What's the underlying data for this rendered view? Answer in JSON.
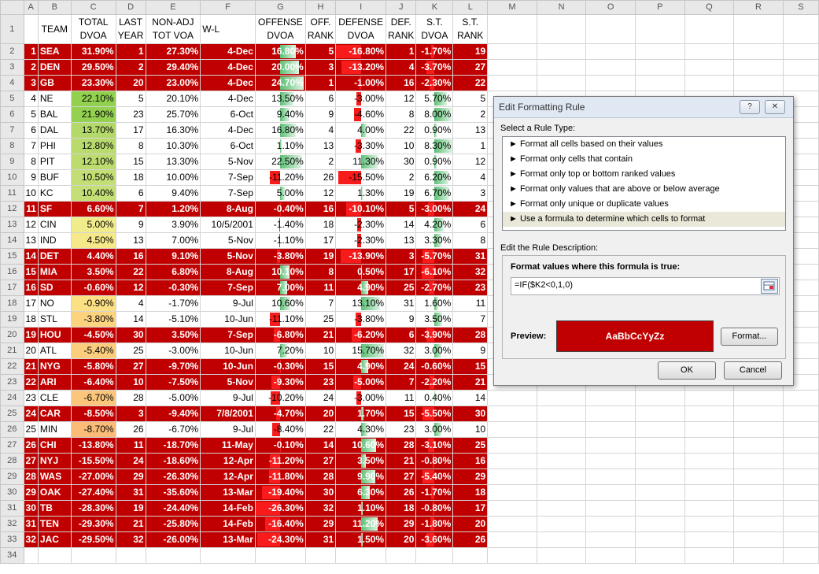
{
  "columns": [
    "A",
    "B",
    "C",
    "D",
    "E",
    "F",
    "G",
    "H",
    "I",
    "J",
    "K",
    "L",
    "M",
    "N",
    "O",
    "P",
    "Q",
    "R",
    "S"
  ],
  "header1": [
    "",
    "",
    "TOTAL",
    "LAST",
    "NON-ADJ",
    "",
    "OFFENSE",
    "OFF.",
    "DEFENSE",
    "DEF.",
    "S.T.",
    "S.T."
  ],
  "header2": [
    "",
    "TEAM",
    "DVOA",
    "YEAR",
    "TOT VOA",
    "W-L",
    "DVOA",
    "RANK",
    "DVOA",
    "RANK",
    "DVOA",
    "RANK"
  ],
  "rows": [
    {
      "rank": "1",
      "team": "SEA",
      "dvoa": "31.90%",
      "last": "1",
      "nonadj": "27.30%",
      "wl": "4-Dec",
      "off": "16.80%",
      "offr": "5",
      "def": "-16.80%",
      "defr": "1",
      "st": "-1.70%",
      "str": "19",
      "neg": true,
      "dvoa_color": "",
      "offv": 16.8,
      "defv": -16.8,
      "stv": -1.7
    },
    {
      "rank": "2",
      "team": "DEN",
      "dvoa": "29.50%",
      "last": "2",
      "nonadj": "29.40%",
      "wl": "4-Dec",
      "off": "20.00%",
      "offr": "3",
      "def": "-13.20%",
      "defr": "4",
      "st": "-3.70%",
      "str": "27",
      "neg": true,
      "dvoa_color": "",
      "offv": 20.0,
      "defv": -13.2,
      "stv": -3.7
    },
    {
      "rank": "3",
      "team": "GB",
      "dvoa": "23.30%",
      "last": "20",
      "nonadj": "23.00%",
      "wl": "4-Dec",
      "off": "24.70%",
      "offr": "1",
      "def": "-1.00%",
      "defr": "16",
      "st": "-2.30%",
      "str": "22",
      "neg": true,
      "dvoa_color": "",
      "offv": 24.7,
      "defv": -1.0,
      "stv": -2.3
    },
    {
      "rank": "4",
      "team": "NE",
      "dvoa": "22.10%",
      "last": "5",
      "nonadj": "20.10%",
      "wl": "4-Dec",
      "off": "13.50%",
      "offr": "6",
      "def": "-3.00%",
      "defr": "12",
      "st": "5.70%",
      "str": "5",
      "neg": false,
      "dvoa_color": "#92d050",
      "offv": 13.5,
      "defv": -3.0,
      "stv": 5.7
    },
    {
      "rank": "5",
      "team": "BAL",
      "dvoa": "21.90%",
      "last": "23",
      "nonadj": "25.70%",
      "wl": "6-Oct",
      "off": "9.40%",
      "offr": "9",
      "def": "-4.60%",
      "defr": "8",
      "st": "8.00%",
      "str": "2",
      "neg": false,
      "dvoa_color": "#95d151",
      "offv": 9.4,
      "defv": -4.6,
      "stv": 8.0
    },
    {
      "rank": "6",
      "team": "DAL",
      "dvoa": "13.70%",
      "last": "17",
      "nonadj": "16.30%",
      "wl": "4-Dec",
      "off": "16.80%",
      "offr": "4",
      "def": "4.00%",
      "defr": "22",
      "st": "0.90%",
      "str": "13",
      "neg": false,
      "dvoa_color": "#b4d96b",
      "offv": 16.8,
      "defv": 4.0,
      "stv": 0.9
    },
    {
      "rank": "7",
      "team": "PHI",
      "dvoa": "12.80%",
      "last": "8",
      "nonadj": "10.30%",
      "wl": "6-Oct",
      "off": "1.10%",
      "offr": "13",
      "def": "-3.30%",
      "defr": "10",
      "st": "8.30%",
      "str": "1",
      "neg": false,
      "dvoa_color": "#b9db6e",
      "offv": 1.1,
      "defv": -3.3,
      "stv": 8.3
    },
    {
      "rank": "8",
      "team": "PIT",
      "dvoa": "12.10%",
      "last": "15",
      "nonadj": "13.30%",
      "wl": "5-Nov",
      "off": "22.50%",
      "offr": "2",
      "def": "11.30%",
      "defr": "30",
      "st": "0.90%",
      "str": "12",
      "neg": false,
      "dvoa_color": "#bcdc70",
      "offv": 22.5,
      "defv": 11.3,
      "stv": 0.9
    },
    {
      "rank": "9",
      "team": "BUF",
      "dvoa": "10.50%",
      "last": "18",
      "nonadj": "10.00%",
      "wl": "7-Sep",
      "off": "-11.20%",
      "offr": "26",
      "def": "-15.50%",
      "defr": "2",
      "st": "6.20%",
      "str": "4",
      "neg": false,
      "dvoa_color": "#c2de74",
      "offv": -11.2,
      "defv": -15.5,
      "stv": 6.2
    },
    {
      "rank": "10",
      "team": "KC",
      "dvoa": "10.40%",
      "last": "6",
      "nonadj": "9.40%",
      "wl": "7-Sep",
      "off": "5.00%",
      "offr": "12",
      "def": "1.30%",
      "defr": "19",
      "st": "6.70%",
      "str": "3",
      "neg": false,
      "dvoa_color": "#c3df75",
      "offv": 5.0,
      "defv": 1.3,
      "stv": 6.7
    },
    {
      "rank": "11",
      "team": "SF",
      "dvoa": "6.60%",
      "last": "7",
      "nonadj": "1.20%",
      "wl": "8-Aug",
      "off": "-0.40%",
      "offr": "16",
      "def": "-10.10%",
      "defr": "5",
      "st": "-3.00%",
      "str": "24",
      "neg": true,
      "dvoa_color": "",
      "offv": -0.4,
      "defv": -10.1,
      "stv": -3.0
    },
    {
      "rank": "12",
      "team": "CIN",
      "dvoa": "5.00%",
      "last": "9",
      "nonadj": "3.90%",
      "wl": "10/5/2001",
      "off": "-1.40%",
      "offr": "18",
      "def": "-2.30%",
      "defr": "14",
      "st": "4.20%",
      "str": "6",
      "neg": false,
      "dvoa_color": "#f0ec8c",
      "offv": -1.4,
      "defv": -2.3,
      "stv": 4.2
    },
    {
      "rank": "13",
      "team": "IND",
      "dvoa": "4.50%",
      "last": "13",
      "nonadj": "7.00%",
      "wl": "5-Nov",
      "off": "-1.10%",
      "offr": "17",
      "def": "-2.30%",
      "defr": "13",
      "st": "3.30%",
      "str": "8",
      "neg": false,
      "dvoa_color": "#f5e98a",
      "offv": -1.1,
      "defv": -2.3,
      "stv": 3.3
    },
    {
      "rank": "14",
      "team": "DET",
      "dvoa": "4.40%",
      "last": "16",
      "nonadj": "9.10%",
      "wl": "5-Nov",
      "off": "-3.80%",
      "offr": "19",
      "def": "-13.90%",
      "defr": "3",
      "st": "-5.70%",
      "str": "31",
      "neg": true,
      "dvoa_color": "",
      "offv": -3.8,
      "defv": -13.9,
      "stv": -5.7
    },
    {
      "rank": "15",
      "team": "MIA",
      "dvoa": "3.50%",
      "last": "22",
      "nonadj": "6.80%",
      "wl": "8-Aug",
      "off": "10.10%",
      "offr": "8",
      "def": "0.50%",
      "defr": "17",
      "st": "-6.10%",
      "str": "32",
      "neg": true,
      "dvoa_color": "",
      "offv": 10.1,
      "defv": 0.5,
      "stv": -6.1
    },
    {
      "rank": "16",
      "team": "SD",
      "dvoa": "-0.60%",
      "last": "12",
      "nonadj": "-0.30%",
      "wl": "7-Sep",
      "off": "7.00%",
      "offr": "11",
      "def": "4.90%",
      "defr": "25",
      "st": "-2.70%",
      "str": "23",
      "neg": true,
      "dvoa_color": "",
      "offv": 7.0,
      "defv": 4.9,
      "stv": -2.7
    },
    {
      "rank": "17",
      "team": "NO",
      "dvoa": "-0.90%",
      "last": "4",
      "nonadj": "-1.70%",
      "wl": "9-Jul",
      "off": "10.60%",
      "offr": "7",
      "def": "13.10%",
      "defr": "31",
      "st": "1.60%",
      "str": "11",
      "neg": false,
      "dvoa_color": "#fce184",
      "offv": 10.6,
      "defv": 13.1,
      "stv": 1.6
    },
    {
      "rank": "18",
      "team": "STL",
      "dvoa": "-3.80%",
      "last": "14",
      "nonadj": "-5.10%",
      "wl": "10-Jun",
      "off": "-11.10%",
      "offr": "25",
      "def": "-3.80%",
      "defr": "9",
      "st": "3.50%",
      "str": "7",
      "neg": false,
      "dvoa_color": "#fcd37f",
      "offv": -11.1,
      "defv": -3.8,
      "stv": 3.5
    },
    {
      "rank": "19",
      "team": "HOU",
      "dvoa": "-4.50%",
      "last": "30",
      "nonadj": "3.50%",
      "wl": "7-Sep",
      "off": "-6.80%",
      "offr": "21",
      "def": "-6.20%",
      "defr": "6",
      "st": "-3.90%",
      "str": "28",
      "neg": true,
      "dvoa_color": "",
      "offv": -6.8,
      "defv": -6.2,
      "stv": -3.9
    },
    {
      "rank": "20",
      "team": "ATL",
      "dvoa": "-5.40%",
      "last": "25",
      "nonadj": "-3.00%",
      "wl": "10-Jun",
      "off": "7.20%",
      "offr": "10",
      "def": "15.70%",
      "defr": "32",
      "st": "3.00%",
      "str": "9",
      "neg": false,
      "dvoa_color": "#fccd7d",
      "offv": 7.2,
      "defv": 15.7,
      "stv": 3.0
    },
    {
      "rank": "21",
      "team": "NYG",
      "dvoa": "-5.80%",
      "last": "27",
      "nonadj": "-9.70%",
      "wl": "10-Jun",
      "off": "-0.30%",
      "offr": "15",
      "def": "4.90%",
      "defr": "24",
      "st": "-0.60%",
      "str": "15",
      "neg": true,
      "dvoa_color": "",
      "offv": -0.3,
      "defv": 4.9,
      "stv": -0.6
    },
    {
      "rank": "22",
      "team": "ARI",
      "dvoa": "-6.40%",
      "last": "10",
      "nonadj": "-7.50%",
      "wl": "5-Nov",
      "off": "-9.30%",
      "offr": "23",
      "def": "-5.00%",
      "defr": "7",
      "st": "-2.20%",
      "str": "21",
      "neg": true,
      "dvoa_color": "",
      "offv": -9.3,
      "defv": -5.0,
      "stv": -2.2
    },
    {
      "rank": "23",
      "team": "CLE",
      "dvoa": "-6.70%",
      "last": "28",
      "nonadj": "-5.00%",
      "wl": "9-Jul",
      "off": "-10.20%",
      "offr": "24",
      "def": "-3.00%",
      "defr": "11",
      "st": "0.40%",
      "str": "14",
      "neg": false,
      "dvoa_color": "#fbc67b",
      "offv": -10.2,
      "defv": -3.0,
      "stv": 0.4
    },
    {
      "rank": "24",
      "team": "CAR",
      "dvoa": "-8.50%",
      "last": "3",
      "nonadj": "-9.40%",
      "wl": "7/8/2001",
      "off": "-4.70%",
      "offr": "20",
      "def": "1.70%",
      "defr": "15",
      "st": "-5.50%",
      "str": "30",
      "neg": true,
      "dvoa_color": "",
      "offv": -4.7,
      "defv": 1.7,
      "stv": -5.5
    },
    {
      "rank": "25",
      "team": "MIN",
      "dvoa": "-8.70%",
      "last": "26",
      "nonadj": "-6.70%",
      "wl": "9-Jul",
      "off": "-8.40%",
      "offr": "22",
      "def": "4.30%",
      "defr": "23",
      "st": "3.00%",
      "str": "10",
      "neg": false,
      "dvoa_color": "#fbbc77",
      "offv": -8.4,
      "defv": 4.3,
      "stv": 3.0
    },
    {
      "rank": "26",
      "team": "CHI",
      "dvoa": "-13.80%",
      "last": "11",
      "nonadj": "-18.70%",
      "wl": "11-May",
      "off": "-0.10%",
      "offr": "14",
      "def": "10.60%",
      "defr": "28",
      "st": "-3.10%",
      "str": "25",
      "neg": true,
      "dvoa_color": "",
      "offv": -0.1,
      "defv": 10.6,
      "stv": -3.1
    },
    {
      "rank": "27",
      "team": "NYJ",
      "dvoa": "-15.50%",
      "last": "24",
      "nonadj": "-18.60%",
      "wl": "12-Apr",
      "off": "-11.20%",
      "offr": "27",
      "def": "3.50%",
      "defr": "21",
      "st": "-0.80%",
      "str": "16",
      "neg": true,
      "dvoa_color": "",
      "offv": -11.2,
      "defv": 3.5,
      "stv": -0.8
    },
    {
      "rank": "28",
      "team": "WAS",
      "dvoa": "-27.00%",
      "last": "29",
      "nonadj": "-26.30%",
      "wl": "12-Apr",
      "off": "-11.80%",
      "offr": "28",
      "def": "9.90%",
      "defr": "27",
      "st": "-5.40%",
      "str": "29",
      "neg": true,
      "dvoa_color": "",
      "offv": -11.8,
      "defv": 9.9,
      "stv": -5.4
    },
    {
      "rank": "29",
      "team": "OAK",
      "dvoa": "-27.40%",
      "last": "31",
      "nonadj": "-35.60%",
      "wl": "13-Mar",
      "off": "-19.40%",
      "offr": "30",
      "def": "6.30%",
      "defr": "26",
      "st": "-1.70%",
      "str": "18",
      "neg": true,
      "dvoa_color": "",
      "offv": -19.4,
      "defv": 6.3,
      "stv": -1.7
    },
    {
      "rank": "30",
      "team": "TB",
      "dvoa": "-28.30%",
      "last": "19",
      "nonadj": "-24.40%",
      "wl": "14-Feb",
      "off": "-26.30%",
      "offr": "32",
      "def": "1.10%",
      "defr": "18",
      "st": "-0.80%",
      "str": "17",
      "neg": true,
      "dvoa_color": "",
      "offv": -26.3,
      "defv": 1.1,
      "stv": -0.8
    },
    {
      "rank": "31",
      "team": "TEN",
      "dvoa": "-29.30%",
      "last": "21",
      "nonadj": "-25.80%",
      "wl": "14-Feb",
      "off": "-16.40%",
      "offr": "29",
      "def": "11.20%",
      "defr": "29",
      "st": "-1.80%",
      "str": "20",
      "neg": true,
      "dvoa_color": "",
      "offv": -16.4,
      "defv": 11.2,
      "stv": -1.8
    },
    {
      "rank": "32",
      "team": "JAC",
      "dvoa": "-29.50%",
      "last": "32",
      "nonadj": "-26.00%",
      "wl": "13-Mar",
      "off": "-24.30%",
      "offr": "31",
      "def": "1.50%",
      "defr": "20",
      "st": "-3.60%",
      "str": "26",
      "neg": true,
      "dvoa_color": "",
      "offv": -24.3,
      "defv": 1.5,
      "stv": -3.6
    }
  ],
  "dialog": {
    "title": "Edit Formatting Rule",
    "help_label": "?",
    "close_label": "✕",
    "select_rule_label": "Select a Rule Type:",
    "rule_types": [
      "► Format all cells based on their values",
      "► Format only cells that contain",
      "► Format only top or bottom ranked values",
      "► Format only values that are above or below average",
      "► Format only unique or duplicate values",
      "► Use a formula to determine which cells to format"
    ],
    "selected_rule_index": 5,
    "edit_desc_label": "Edit the Rule Description:",
    "formula_label": "Format values where this formula is true:",
    "formula_value": "=IF($K2<0,1,0)",
    "preview_label": "Preview:",
    "preview_text": "AaBbCcYyZz",
    "format_button": "Format...",
    "ok_button": "OK",
    "cancel_button": "Cancel",
    "preview_bg": "#c00000"
  }
}
